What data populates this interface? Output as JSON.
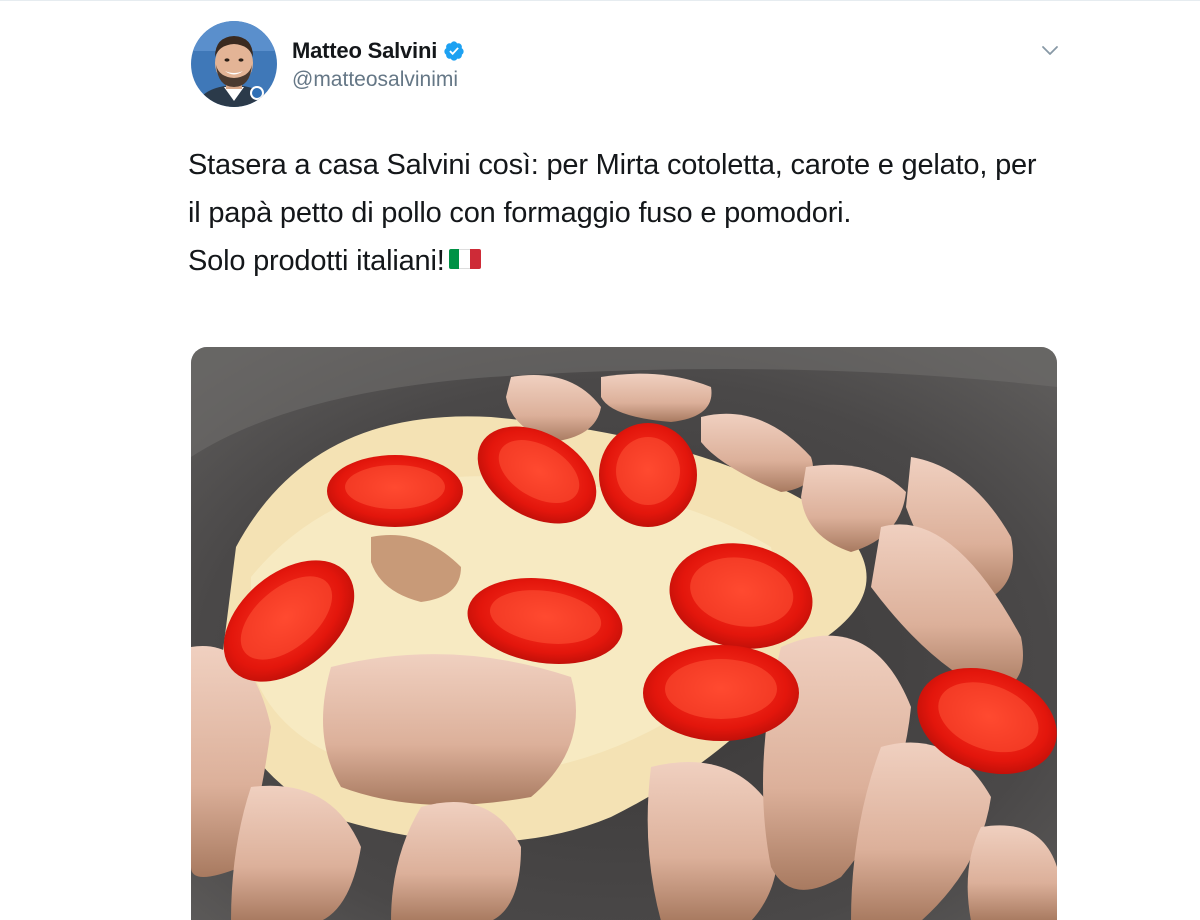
{
  "tweet": {
    "author": {
      "display_name": "Matteo Salvini",
      "handle": "@matteosalvinimi",
      "verified": true,
      "avatar_icon": "profile-photo",
      "verified_icon": "verified-badge-icon"
    },
    "menu_icon": "chevron-down-icon",
    "text": {
      "line1": "Stasera a casa Salvini così: per Mirta cotoletta, carote e gelato, per il papà petto di pollo con formaggio fuso e pomodori.",
      "line2": "Solo prodotti italiani!",
      "emoji": "flag-italy-icon"
    },
    "media": {
      "type": "photo",
      "subject": "chicken-breast-with-melted-cheese-and-cherry-tomatoes-in-pan"
    }
  },
  "colors": {
    "text_primary": "#14171a",
    "text_secondary": "#657786",
    "verified_blue": "#1da1f2",
    "flag_green": "#009246",
    "flag_white": "#ffffff",
    "flag_red": "#ce2b37"
  }
}
